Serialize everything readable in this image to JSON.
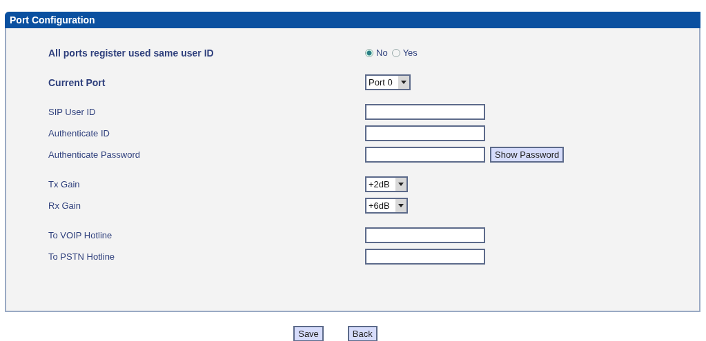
{
  "panel": {
    "title": "Port Configuration",
    "groups": [
      {
        "rows": [
          {
            "kind": "radio",
            "label": "All ports register used same user ID",
            "bold": true,
            "options": [
              {
                "label": "No",
                "selected": true
              },
              {
                "label": "Yes",
                "selected": false
              }
            ]
          }
        ]
      },
      {
        "rows": [
          {
            "kind": "select",
            "label": "Current Port",
            "bold": true,
            "value": "Port 0"
          }
        ]
      },
      {
        "rows": [
          {
            "kind": "text",
            "label": "SIP User ID",
            "bold": false
          },
          {
            "kind": "text",
            "label": "Authenticate ID",
            "bold": false
          },
          {
            "kind": "password",
            "label": "Authenticate Password",
            "bold": false,
            "button": "Show Password"
          }
        ]
      },
      {
        "rows": [
          {
            "kind": "select",
            "label": "Tx Gain",
            "bold": false,
            "value": "+2dB"
          },
          {
            "kind": "select",
            "label": "Rx Gain",
            "bold": false,
            "value": "+6dB"
          }
        ]
      },
      {
        "rows": [
          {
            "kind": "text",
            "label": "To VOIP Hotline",
            "bold": false
          },
          {
            "kind": "text",
            "label": "To PSTN Hotline",
            "bold": false
          }
        ]
      }
    ]
  },
  "buttons": [
    "Save",
    "Back"
  ]
}
